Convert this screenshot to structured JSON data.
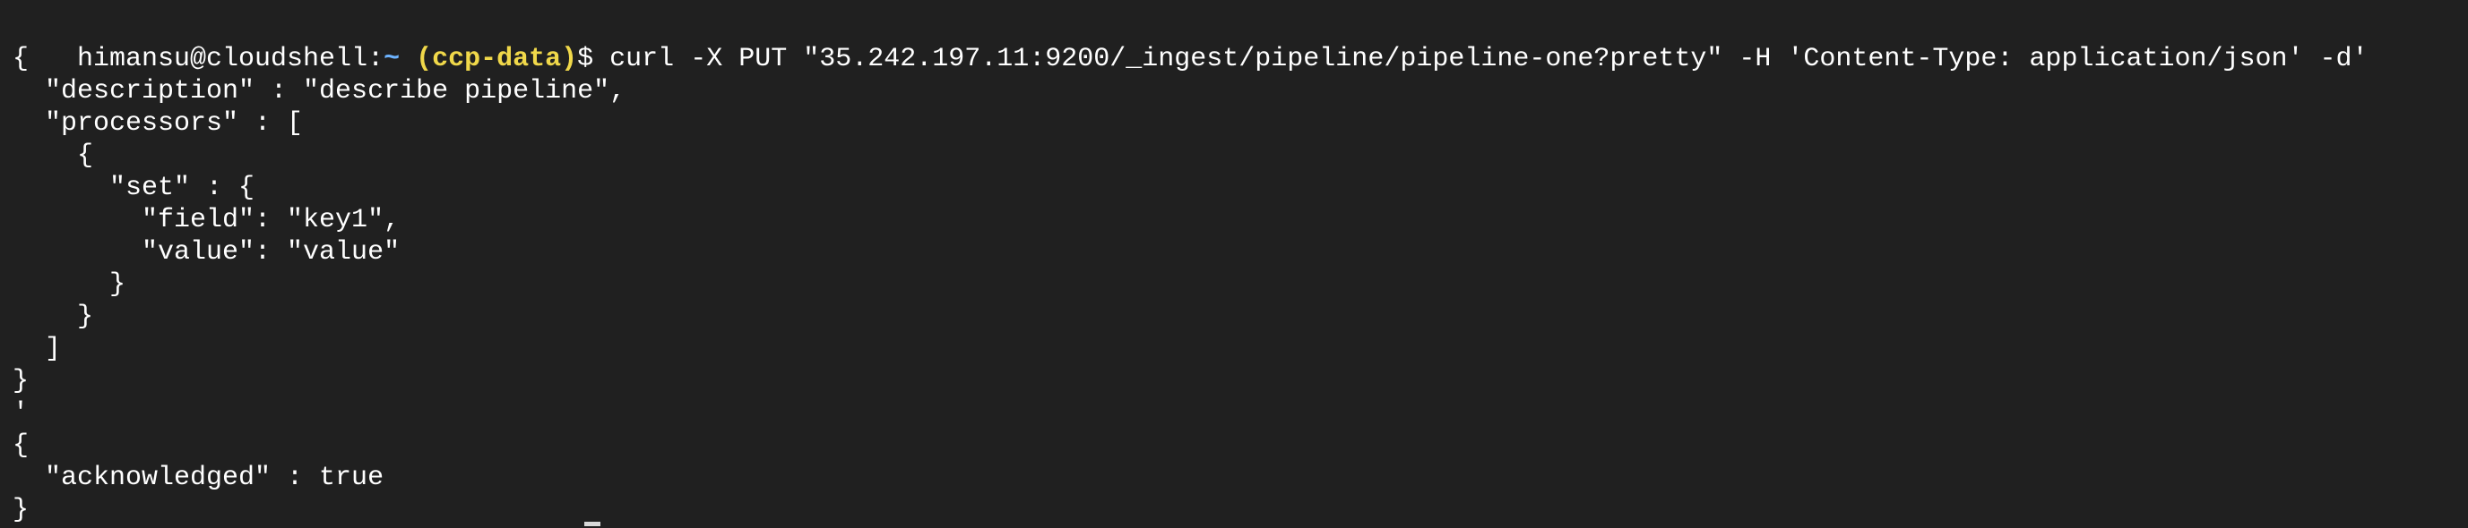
{
  "prompt": {
    "user_host": "himansu@cloudshell",
    "separator": ":",
    "path": "~",
    "project": "(ccp-data)",
    "dollar": "$"
  },
  "command": " curl -X PUT \"35.242.197.11:9200/_ingest/pipeline/pipeline-one?pretty\" -H 'Content-Type: application/json' -d'",
  "output_lines": [
    "{",
    "  \"description\" : \"describe pipeline\",",
    "  \"processors\" : [",
    "    {",
    "      \"set\" : {",
    "        \"field\": \"key1\",",
    "        \"value\": \"value\"",
    "      }",
    "    }",
    "  ]",
    "}",
    "'",
    "{",
    "  \"acknowledged\" : true",
    "}"
  ],
  "colors": {
    "background": "#202020",
    "text": "#ffffff",
    "path": "#6db3ff",
    "project": "#f0d84a"
  }
}
